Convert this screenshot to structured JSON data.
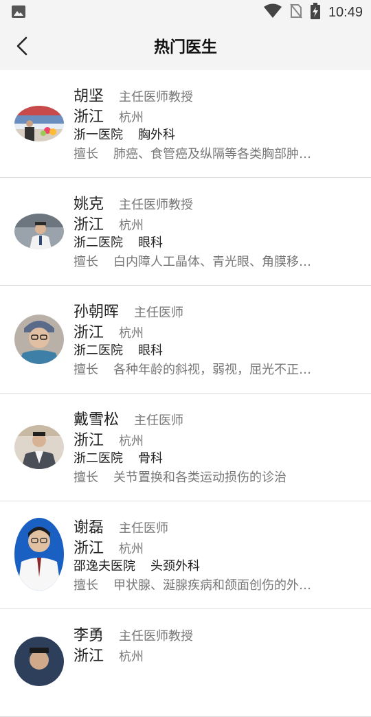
{
  "status_bar": {
    "time": "10:49",
    "icons": [
      "image-icon",
      "wifi-icon",
      "no-sim-icon",
      "battery-charging-icon"
    ]
  },
  "header": {
    "back_icon": "chevron-left-icon",
    "title": "热门医生"
  },
  "doctors": [
    {
      "name": "胡坚",
      "title": "主任医师教授",
      "province": "浙江",
      "city": "杭州",
      "hospital": "浙一医院",
      "department": "胸外科",
      "specialty_label": "擅长",
      "specialty": "肺癌、食管癌及纵隔等各类胸部肿…"
    },
    {
      "name": "姚克",
      "title": "主任医师教授",
      "province": "浙江",
      "city": "杭州",
      "hospital": "浙二医院",
      "department": "眼科",
      "specialty_label": "擅长",
      "specialty": "白内障人工晶体、青光眼、角膜移…"
    },
    {
      "name": "孙朝晖",
      "title": "主任医师",
      "province": "浙江",
      "city": "杭州",
      "hospital": "浙二医院",
      "department": "眼科",
      "specialty_label": "擅长",
      "specialty": "各种年龄的斜视，弱视，屈光不正…"
    },
    {
      "name": "戴雪松",
      "title": "主任医师",
      "province": "浙江",
      "city": "杭州",
      "hospital": "浙二医院",
      "department": "骨科",
      "specialty_label": "擅长",
      "specialty": "关节置换和各类运动损伤的诊治"
    },
    {
      "name": "谢磊",
      "title": "主任医师",
      "province": "浙江",
      "city": "杭州",
      "hospital": "邵逸夫医院",
      "department": "头颈外科",
      "specialty_label": "擅长",
      "specialty": "甲状腺、涎腺疾病和颌面创伤的外…"
    },
    {
      "name": "李勇",
      "title": "主任医师教授",
      "province": "浙江",
      "city": "杭州",
      "hospital": "",
      "department": "",
      "specialty_label": "",
      "specialty": ""
    }
  ]
}
